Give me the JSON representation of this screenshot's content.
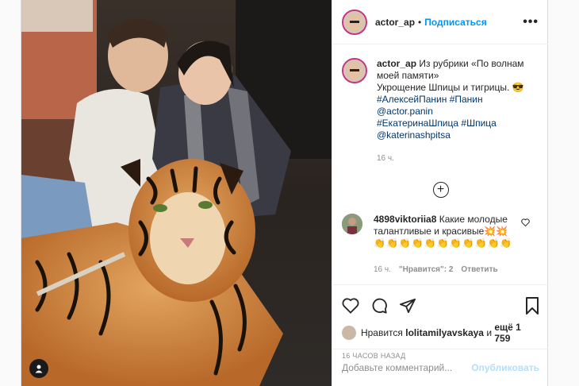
{
  "post": {
    "author": "actor_ap",
    "follow_label": "Подписаться",
    "more_label": "•••",
    "caption": {
      "username": "actor_ap",
      "line1": "Из рубрики «По волнам моей памяти»",
      "line2": "Укрощение Шпицы и тигрицы. 😎",
      "tags1": "#АлексейПанин #Панин",
      "mention1": "@actor.panin",
      "tags2": "#ЕкатеринаШпица #Шпица",
      "mention2": "@katerinashpitsa",
      "time": "16 ч."
    },
    "comment": {
      "username": "4898viktoriia8",
      "text": "Какие молодые талантливые и красивые💥💥",
      "emojis": "👏👏👏👏👏👏👏👏👏👏👏",
      "time": "16 ч.",
      "likes": "\"Нравится\": 2",
      "reply": "Ответить"
    },
    "likes": {
      "prefix": "Нравится",
      "user": "lolitamilyavskaya",
      "middle": "и",
      "others": "ещё 1 759"
    },
    "timestamp": "16 ЧАСОВ НАЗАД",
    "add_comment_placeholder": "Добавьте комментарий...",
    "publish_label": "Опубликовать"
  },
  "icons": {
    "like": "heart-icon",
    "comment": "comment-icon",
    "share": "share-icon",
    "save": "bookmark-icon",
    "tag": "user-tag-icon",
    "load_more": "plus-circle-icon"
  }
}
